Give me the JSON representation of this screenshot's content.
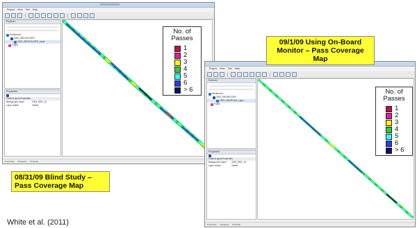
{
  "windows": [
    {
      "menu": [
        "Project",
        "View",
        "Tool",
        "Help"
      ],
      "explorer_title": "Explorer",
      "tree": [
        "Workbench",
        "2009_0831SOLDIER",
        "2009_0831SOLDIER_Layer",
        "Folder"
      ],
      "properties_title": "Properties",
      "prop_section": "Folder/Layout Properties",
      "props": [
        [
          "Background name",
          "2009_0831_01"
        ],
        [
          "Layer visible",
          "Visible"
        ]
      ],
      "bottom_tabs": [
        "Properties",
        "Navigator",
        "Potential"
      ],
      "legend": {
        "title": "No. of Passes",
        "items": [
          {
            "label": "1",
            "color": "#c0123c"
          },
          {
            "label": "2",
            "color": "#e6199c"
          },
          {
            "label": "3",
            "color": "#ffff00"
          },
          {
            "label": "4",
            "color": "#33cc33"
          },
          {
            "label": "5",
            "color": "#33ffff"
          },
          {
            "label": "6",
            "color": "#2040e6"
          },
          {
            "label": "> 6",
            "color": "#101060"
          }
        ]
      },
      "caption": "08/31/09 Blind Study – Pass Coverage Map"
    },
    {
      "menu": [
        "Project",
        "View",
        "Tool",
        "Help"
      ],
      "explorer_title": "Explorer",
      "tree": [
        "Workbench",
        "2009_0901REGION",
        "2009_0901ROAD_Layer",
        "Folder"
      ],
      "properties_title": "Properties",
      "prop_section": "Folder/Layout Properties",
      "props": [
        [
          "Background name",
          "2009_0901_01"
        ],
        [
          "Layer visible",
          "Visible"
        ]
      ],
      "bottom_tabs": [
        "Properties",
        "Navigator",
        "Potential"
      ],
      "legend": {
        "title": "No. of Passes",
        "items": [
          {
            "label": "1",
            "color": "#c0123c"
          },
          {
            "label": "2",
            "color": "#e6199c"
          },
          {
            "label": "3",
            "color": "#ffff00"
          },
          {
            "label": "4",
            "color": "#33cc33"
          },
          {
            "label": "5",
            "color": "#33ffff"
          },
          {
            "label": "6",
            "color": "#2040e6"
          },
          {
            "label": "> 6",
            "color": "#101060"
          }
        ]
      },
      "caption": "09/1/09 Using On-Board Monitor – Pass Coverage Map"
    }
  ],
  "citation": "White et al. (2011)"
}
